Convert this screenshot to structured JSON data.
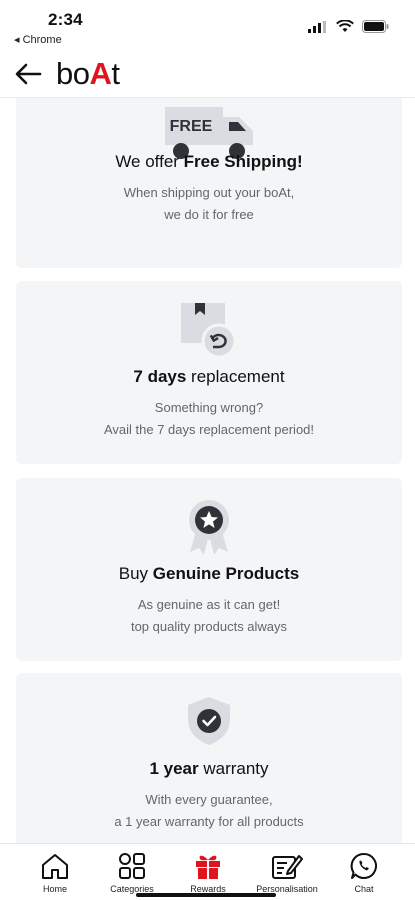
{
  "status": {
    "time": "2:34",
    "back_app": "◂ Chrome"
  },
  "header": {
    "logo_prefix": "bo",
    "logo_accent": "A",
    "logo_suffix": "t"
  },
  "cards": [
    {
      "icon_text": "FREE",
      "title_plain": "We offer ",
      "title_bold": "Free Shipping!",
      "title_bold_first": false,
      "desc1": "When shipping out your boAt,",
      "desc2": "we do it for free"
    },
    {
      "title_bold": "7 days",
      "title_plain": " replacement",
      "title_bold_first": true,
      "desc1": "Something wrong?",
      "desc2": "Avail the 7 days replacement period!"
    },
    {
      "title_plain": "Buy ",
      "title_bold": "Genuine Products",
      "title_bold_first": false,
      "desc1": "As genuine as it can get!",
      "desc2": "top quality products always"
    },
    {
      "title_bold": "1 year",
      "title_plain": " warranty",
      "title_bold_first": true,
      "desc1": "With every guarantee,",
      "desc2": "a 1 year warranty for all products"
    }
  ],
  "nav": [
    {
      "label": "Home",
      "icon": "home-icon"
    },
    {
      "label": "Categories",
      "icon": "categories-icon"
    },
    {
      "label": "Rewards",
      "icon": "gift-icon"
    },
    {
      "label": "Personalisation",
      "icon": "personalisation-icon"
    },
    {
      "label": "Chat",
      "icon": "chat-icon"
    }
  ],
  "colors": {
    "accent": "#e0141e",
    "card_bg": "#f3f5f7",
    "icon_dark": "#2f3338",
    "icon_light": "#d9dde1"
  }
}
